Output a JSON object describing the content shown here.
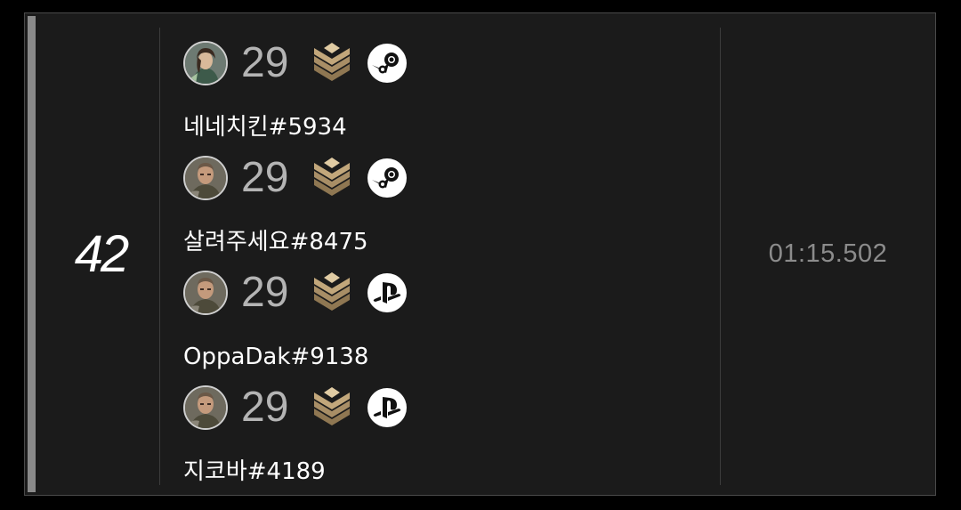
{
  "entry": {
    "rank": "42",
    "time": "01:15.502"
  },
  "players": [
    {
      "level": "29",
      "name": "네네치킨#5934",
      "platform": "steam-icon",
      "avatar": "female-character-avatar",
      "rank_badge": "gold-chevron-rank-icon"
    },
    {
      "level": "29",
      "name": "살려주세요#8475",
      "platform": "steam-icon",
      "avatar": "male-character-avatar",
      "rank_badge": "gold-chevron-rank-icon"
    },
    {
      "level": "29",
      "name": "OppaDak#9138",
      "platform": "playstation-icon",
      "avatar": "male-character-avatar",
      "rank_badge": "gold-chevron-rank-icon"
    },
    {
      "level": "29",
      "name": "지코바#4189",
      "platform": "playstation-icon",
      "avatar": "male-character-avatar",
      "rank_badge": "gold-chevron-rank-icon"
    }
  ],
  "colors": {
    "card_bg": "#1b1b1b",
    "accent_bar": "#8a8a8a",
    "level_text": "#b4b4b4",
    "time_text": "#8c8c8c",
    "rank_badge_gold": "#a88e66"
  }
}
